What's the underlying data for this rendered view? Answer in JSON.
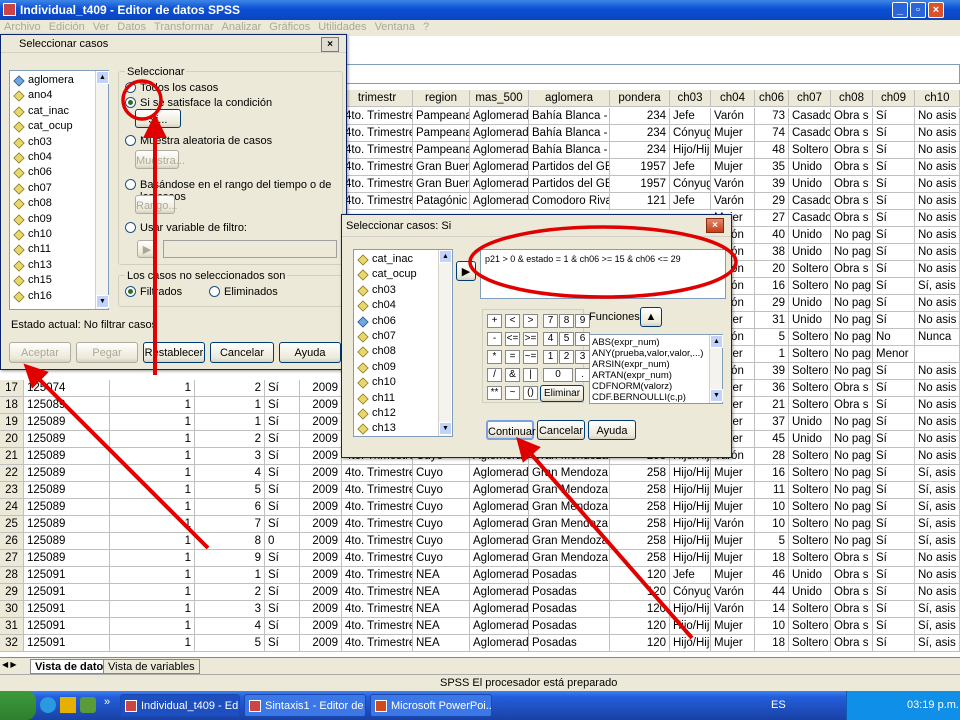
{
  "window": {
    "title": "Individual_t409 - Editor de datos SPSS",
    "menu": [
      "Archivo",
      "Edición",
      "Ver",
      "Datos",
      "Transformar",
      "Analizar",
      "Gráficos",
      "Utilidades",
      "Ventana",
      "?"
    ]
  },
  "grid": {
    "columns": [
      "trimestr",
      "region",
      "mas_500",
      "aglomera",
      "pondera",
      "ch03",
      "ch04",
      "ch06",
      "ch07",
      "ch08",
      "ch09",
      "ch10"
    ],
    "top_rows": [
      [
        "4to. Trimestre",
        "Pampeana",
        "Aglomerado",
        "Bahía Blanca - C",
        "234",
        "Jefe",
        "Varón",
        "73",
        "Casado",
        "Obra s",
        "Sí",
        "No asis"
      ],
      [
        "4to. Trimestre",
        "Pampeana",
        "Aglomerado",
        "Bahía Blanca - C",
        "234",
        "Cónyug",
        "Mujer",
        "74",
        "Casado",
        "Obra s",
        "Sí",
        "No asis"
      ],
      [
        "4to. Trimestre",
        "Pampeana",
        "Aglomerado",
        "Bahía Blanca - C",
        "234",
        "Hijo/Hij",
        "Mujer",
        "48",
        "Soltero",
        "Obra s",
        "Sí",
        "No asis"
      ],
      [
        "4to. Trimestre",
        "Gran Buen",
        "Aglomerado",
        "Partidos del GB",
        "1957",
        "Jefe",
        "Mujer",
        "35",
        "Unido",
        "Obra s",
        "Sí",
        "No asis"
      ],
      [
        "4to. Trimestre",
        "Gran Buen",
        "Aglomerado",
        "Partidos del GB",
        "1957",
        "Cónyug",
        "Varón",
        "39",
        "Unido",
        "Obra s",
        "Sí",
        "No asis"
      ],
      [
        "4to. Trimestre",
        "Patagónic",
        "Aglomerado",
        "Comodoro Rivad",
        "121",
        "Jefe",
        "Varón",
        "29",
        "Casado",
        "Obra s",
        "Sí",
        "No asis"
      ]
    ],
    "partial_right_rows": [
      [
        "Mujer",
        "27",
        "Casado",
        "Obra s",
        "Sí",
        "No asis"
      ],
      [
        "Varón",
        "40",
        "Unido",
        "No pag",
        "Sí",
        "No asis"
      ],
      [
        "Varón",
        "38",
        "Unido",
        "No pag",
        "Sí",
        "No asis"
      ],
      [
        "Varón",
        "20",
        "Soltero",
        "Obra s",
        "Sí",
        "No asis"
      ],
      [
        "Varón",
        "16",
        "Soltero",
        "No pag",
        "Sí",
        "Sí, asis"
      ],
      [
        "Varón",
        "29",
        "Unido",
        "No pag",
        "Sí",
        "No asis"
      ],
      [
        "Mujer",
        "31",
        "Unido",
        "No pag",
        "Sí",
        "No asis"
      ],
      [
        "Varón",
        "5",
        "Soltero",
        "No pag",
        "No",
        "Nunca"
      ],
      [
        "Mujer",
        "1",
        "Soltero",
        "No pag",
        "Menor",
        ""
      ],
      [
        "Varón",
        "39",
        "Soltero",
        "No pag",
        "Sí",
        "No asis"
      ],
      [
        "Mujer",
        "36",
        "Soltero",
        "Obra s",
        "Sí",
        "No asis"
      ],
      [
        "Mujer",
        "21",
        "Soltero",
        "Obra s",
        "Sí",
        "No asis"
      ],
      [
        "Mujer",
        "37",
        "Unido",
        "No pag",
        "Sí",
        "No asis"
      ],
      [
        "Mujer",
        "45",
        "Unido",
        "No pag",
        "Sí",
        "No asis"
      ]
    ],
    "left_rows": [
      [
        "17",
        "125074",
        "1",
        "2",
        "Sí",
        "2009"
      ],
      [
        "18",
        "125089",
        "1",
        "1",
        "Sí",
        "2009"
      ],
      [
        "19",
        "125089",
        "1",
        "1",
        "Sí",
        "2009"
      ],
      [
        "20",
        "125089",
        "1",
        "2",
        "Sí",
        "2009"
      ]
    ],
    "bottom_rows": [
      [
        "21",
        "125089",
        "1",
        "3",
        "Sí",
        "2009",
        "4to. Trimestre",
        "Cuyo",
        "Aglomerado",
        "Gran Mendoza",
        "258",
        "Hijo/Hij",
        "Varón",
        "28",
        "Soltero",
        "No pag",
        "Sí",
        "No asis"
      ],
      [
        "22",
        "125089",
        "1",
        "4",
        "Sí",
        "2009",
        "4to. Trimestre",
        "Cuyo",
        "Aglomerado",
        "Gran Mendoza",
        "258",
        "Hijo/Hij",
        "Mujer",
        "16",
        "Soltero",
        "No pag",
        "Sí",
        "Sí, asis"
      ],
      [
        "23",
        "125089",
        "1",
        "5",
        "Sí",
        "2009",
        "4to. Trimestre",
        "Cuyo",
        "Aglomerado",
        "Gran Mendoza",
        "258",
        "Hijo/Hij",
        "Mujer",
        "11",
        "Soltero",
        "No pag",
        "Sí",
        "Sí, asis"
      ],
      [
        "24",
        "125089",
        "1",
        "6",
        "Sí",
        "2009",
        "4to. Trimestre",
        "Cuyo",
        "Aglomerado",
        "Gran Mendoza",
        "258",
        "Hijo/Hij",
        "Mujer",
        "10",
        "Soltero",
        "No pag",
        "Sí",
        "Sí, asis"
      ],
      [
        "25",
        "125089",
        "1",
        "7",
        "Sí",
        "2009",
        "4to. Trimestre",
        "Cuyo",
        "Aglomerado",
        "Gran Mendoza",
        "258",
        "Hijo/Hij",
        "Varón",
        "10",
        "Soltero",
        "No pag",
        "Sí",
        "Sí, asis"
      ],
      [
        "26",
        "125089",
        "1",
        "8",
        "0",
        "2009",
        "4to. Trimestre",
        "Cuyo",
        "Aglomerado",
        "Gran Mendoza",
        "258",
        "Hijo/Hij",
        "Mujer",
        "5",
        "Soltero",
        "No pag",
        "Sí",
        "Sí, asis"
      ],
      [
        "27",
        "125089",
        "1",
        "9",
        "Sí",
        "2009",
        "4to. Trimestre",
        "Cuyo",
        "Aglomerado",
        "Gran Mendoza",
        "258",
        "Hijo/Hij",
        "Mujer",
        "18",
        "Soltero",
        "Obra s",
        "Sí",
        "No asis"
      ],
      [
        "28",
        "125091",
        "1",
        "1",
        "Sí",
        "2009",
        "4to. Trimestre",
        "NEA",
        "Aglomerado",
        "Posadas",
        "120",
        "Jefe",
        "Mujer",
        "46",
        "Unido",
        "Obra s",
        "Sí",
        "No asis"
      ],
      [
        "29",
        "125091",
        "1",
        "2",
        "Sí",
        "2009",
        "4to. Trimestre",
        "NEA",
        "Aglomerado",
        "Posadas",
        "120",
        "Cónyug",
        "Varón",
        "44",
        "Unido",
        "Obra s",
        "Sí",
        "No asis"
      ],
      [
        "30",
        "125091",
        "1",
        "3",
        "Sí",
        "2009",
        "4to. Trimestre",
        "NEA",
        "Aglomerado",
        "Posadas",
        "120",
        "Hijo/Hij",
        "Varón",
        "14",
        "Soltero",
        "Obra s",
        "Sí",
        "Sí, asis"
      ],
      [
        "31",
        "125091",
        "1",
        "4",
        "Sí",
        "2009",
        "4to. Trimestre",
        "NEA",
        "Aglomerado",
        "Posadas",
        "120",
        "Hijo/Hij",
        "Mujer",
        "10",
        "Soltero",
        "Obra s",
        "Sí",
        "Sí, asis"
      ],
      [
        "32",
        "125091",
        "1",
        "5",
        "Sí",
        "2009",
        "4to. Trimestre",
        "NEA",
        "Aglomerado",
        "Posadas",
        "120",
        "Hijo/Hij",
        "Mujer",
        "18",
        "Soltero",
        "Obra s",
        "Sí",
        "Sí, asis"
      ]
    ]
  },
  "tabs": {
    "data_view": "Vista de datos",
    "variable_view": "Vista de variables"
  },
  "status": "SPSS El procesador  está preparado",
  "select_dialog": {
    "title": "Seleccionar casos",
    "variables": [
      "aglomera",
      "ano4",
      "cat_inac",
      "cat_ocup",
      "ch03",
      "ch04",
      "ch06",
      "ch07",
      "ch08",
      "ch09",
      "ch10",
      "ch11",
      "ch13",
      "ch15",
      "ch16"
    ],
    "group_label": "Seleccionar",
    "opt_all": "Todos los casos",
    "opt_cond": "Si se satisface la condición",
    "btn_si": "Si...",
    "opt_random": "Muestra aleatoria de casos",
    "btn_sample": "Muestra...",
    "opt_range": "Basándose en el rango del tiempo o de los casos",
    "btn_range": "Rango...",
    "opt_filter": "Usar variable de filtro:",
    "unselected_label": "Los casos no seleccionados son",
    "opt_filtered": "Filtrados",
    "opt_deleted": "Eliminados",
    "state": "Estado actual: No filtrar casos",
    "buttons": {
      "ok": "Aceptar",
      "paste": "Pegar",
      "reset": "Restablecer",
      "cancel": "Cancelar",
      "help": "Ayuda"
    }
  },
  "if_dialog": {
    "title": "Seleccionar casos: Si",
    "variables": [
      "cat_inac",
      "cat_ocup",
      "ch03",
      "ch04",
      "ch06",
      "ch07",
      "ch08",
      "ch09",
      "ch10",
      "ch11",
      "ch12",
      "ch13"
    ],
    "expression": "p21 > 0 & estado = 1 & ch06 >= 15 & ch06  <= 29",
    "keypad": [
      "+",
      "<",
      ">",
      "7",
      "8",
      "9",
      "-",
      "<=",
      ">=",
      "4",
      "5",
      "6",
      "*",
      "=",
      "~=",
      "1",
      "2",
      "3",
      "/",
      "&",
      "|",
      "0",
      ".",
      "**",
      "~",
      "()"
    ],
    "delete": "Eliminar",
    "functions_label": "Funciones:",
    "functions": [
      "ABS(expr_num)",
      "ANY(prueba,valor,valor,...)",
      "ARSIN(expr_num)",
      "ARTAN(expr_num)",
      "CDFNORM(valorz)",
      "CDF.BERNOULLI(c,p)"
    ],
    "buttons": {
      "continue": "Continuar",
      "cancel": "Cancelar",
      "help": "Ayuda"
    }
  },
  "taskbar": {
    "items": [
      "Individual_t409 - Edi...",
      "Sintaxis1 - Editor de ...",
      "Microsoft PowerPoi..."
    ],
    "lang": "ES",
    "clock": "03:19 p.m."
  },
  "colors": {
    "highlight": "#e00000",
    "title_blue": "#0b4fd4",
    "dialog_bg": "#ece9d8"
  }
}
